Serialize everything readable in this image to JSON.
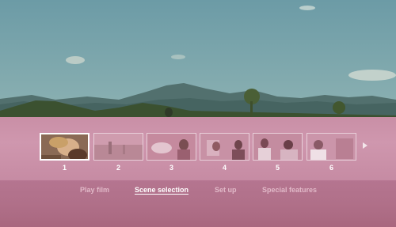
{
  "scenes": {
    "selected_index": 0,
    "items": [
      {
        "number": "1"
      },
      {
        "number": "2"
      },
      {
        "number": "3"
      },
      {
        "number": "4"
      },
      {
        "number": "5"
      },
      {
        "number": "6"
      }
    ],
    "next_icon": "triangle-right-icon"
  },
  "menu": {
    "items": [
      {
        "label": "Play film"
      },
      {
        "label": "Scene selection"
      },
      {
        "label": "Set up"
      },
      {
        "label": "Special features"
      }
    ],
    "active_index": 1
  },
  "colors": {
    "band": "#cf97ae",
    "menu_band": "#b07089",
    "menu_text": "#e1b9c8",
    "menu_active": "#ffffff"
  }
}
